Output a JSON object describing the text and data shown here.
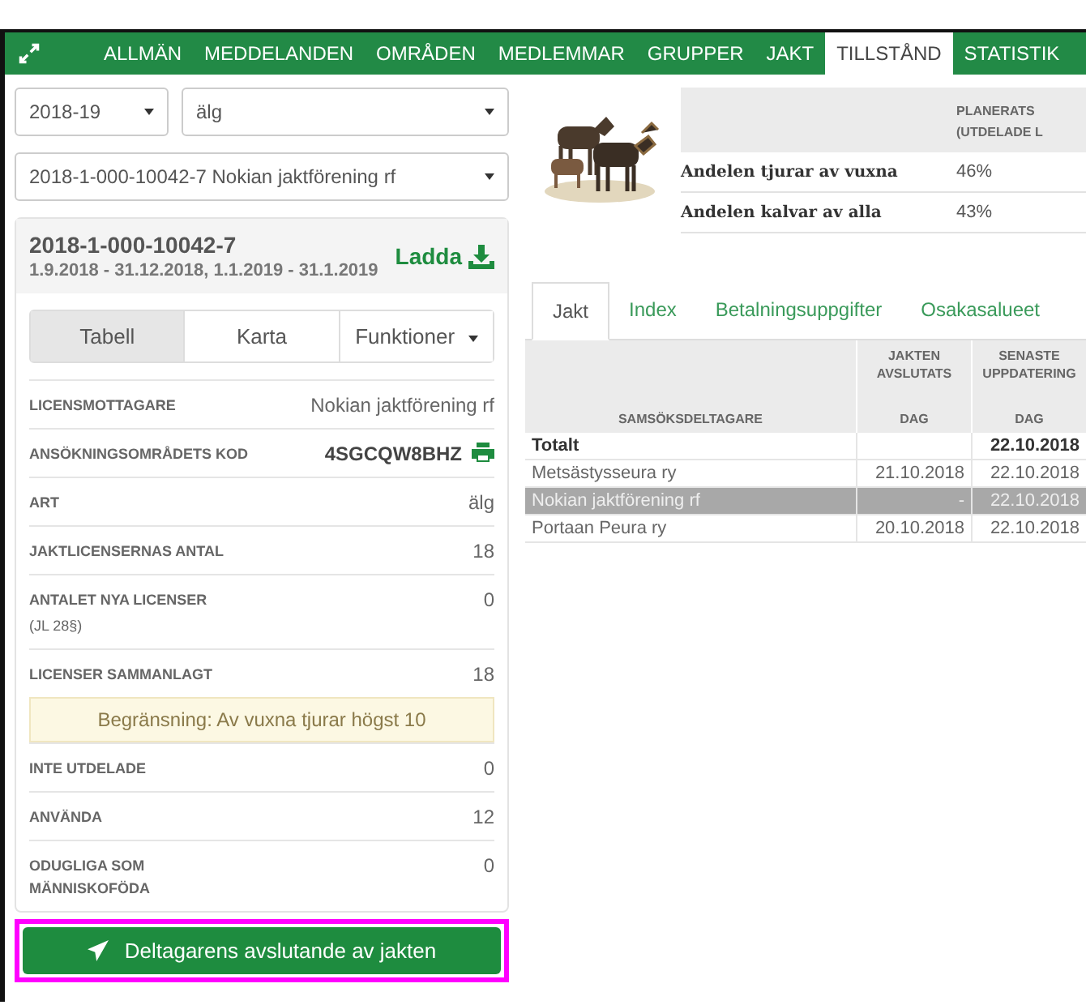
{
  "nav": [
    {
      "label": "ALLMÄN",
      "selected": false
    },
    {
      "label": "MEDDELANDEN",
      "selected": false
    },
    {
      "label": "OMRÅDEN",
      "selected": false
    },
    {
      "label": "MEDLEMMAR",
      "selected": false
    },
    {
      "label": "GRUPPER",
      "selected": false
    },
    {
      "label": "JAKT",
      "selected": false
    },
    {
      "label": "TILLSTÅND",
      "selected": true
    },
    {
      "label": "STATISTIK",
      "selected": false
    }
  ],
  "filters": {
    "season": "2018-19",
    "species": "älg",
    "permit": "2018-1-000-10042-7 Nokian jaktförening rf"
  },
  "permit_card": {
    "number": "2018-1-000-10042-7",
    "dates": "1.9.2018 - 31.12.2018, 1.1.2019 - 31.1.2019",
    "download_label": "Ladda"
  },
  "view_tabs": [
    {
      "label": "Tabell",
      "selected": true,
      "kind": "tab"
    },
    {
      "label": "Karta",
      "selected": false,
      "kind": "tab"
    },
    {
      "label": "Funktioner",
      "selected": false,
      "kind": "dropdown"
    }
  ],
  "details": [
    {
      "kind": "row",
      "label": "LICENSMOTTAGARE",
      "value": "Nokian jaktförening rf"
    },
    {
      "kind": "code",
      "label": "ANSÖKNINGSOMRÅDETS KOD",
      "value": "4SGCQW8BHZ"
    },
    {
      "kind": "row",
      "label": "ART",
      "value": "älg"
    },
    {
      "kind": "row",
      "label": "JAKTLICENSERNAS ANTAL",
      "value": "18"
    },
    {
      "kind": "row",
      "label": "ANTALET NYA LICENSER",
      "sublabel": "(JL 28§)",
      "value": "0"
    },
    {
      "kind": "row",
      "label": "LICENSER SAMMANLAGT",
      "value": "18"
    },
    {
      "kind": "notice",
      "label": "Begränsning: Av vuxna tjurar högst 10"
    },
    {
      "kind": "row",
      "label": "INTE UTDELADE",
      "value": "0"
    },
    {
      "kind": "row",
      "label": "ANVÄNDA",
      "value": "12"
    },
    {
      "kind": "row",
      "label": "ODUGLIGA SOM MÄNNISKOFÖDA",
      "value": "0"
    }
  ],
  "action_button": {
    "label": "Deltagarens avslutande av jakten"
  },
  "ratio_table": {
    "header": [
      "PLANERATS",
      "(UTDELADE L"
    ],
    "rows": [
      {
        "label": "Andelen tjurar av vuxna",
        "value": "46%"
      },
      {
        "label": "Andelen kalvar av alla",
        "value": "43%"
      }
    ]
  },
  "tabs": [
    {
      "label": "Jakt",
      "selected": true
    },
    {
      "label": "Index",
      "selected": false
    },
    {
      "label": "Betalningsuppgifter",
      "selected": false
    },
    {
      "label": "Osakasalueet",
      "selected": false
    }
  ],
  "table": {
    "first_column": "SAMSÖKSDELTAGARE",
    "columns": [
      {
        "lines": [
          "JAKTEN",
          "AVSLUTATS"
        ],
        "unit": "DAG"
      },
      {
        "lines": [
          "SENASTE",
          "UPPDATERING"
        ],
        "unit": "DAG"
      }
    ],
    "rows": [
      {
        "kind": "total",
        "name": "Totalt",
        "cells": [
          "",
          "22.10.2018"
        ],
        "selected": false
      },
      {
        "kind": "row",
        "name": "Metsästysseura ry",
        "cells": [
          "21.10.2018",
          "22.10.2018"
        ],
        "selected": false
      },
      {
        "kind": "row",
        "name": "Nokian jaktförening rf",
        "cells": [
          "-",
          "22.10.2018"
        ],
        "selected": true
      },
      {
        "kind": "row",
        "name": "Portaan Peura ry",
        "cells": [
          "20.10.2018",
          "22.10.2018"
        ],
        "selected": false
      }
    ]
  }
}
